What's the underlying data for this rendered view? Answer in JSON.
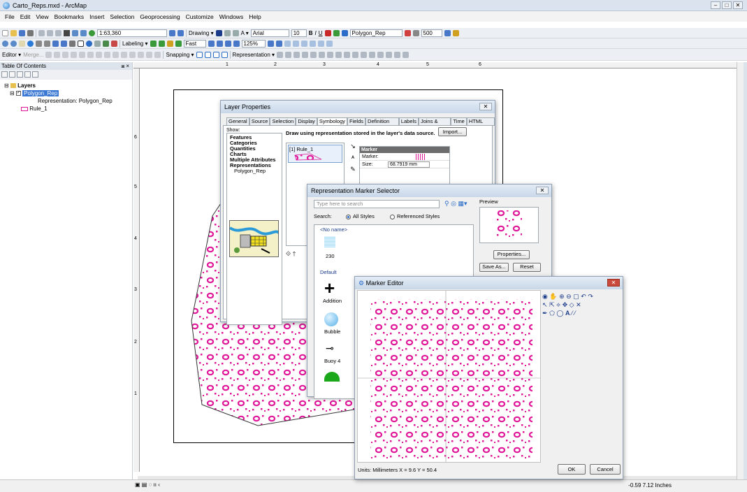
{
  "window": {
    "title": "Carto_Reps.mxd - ArcMap",
    "controls": [
      "–",
      "□",
      "✕"
    ]
  },
  "menu": [
    "File",
    "Edit",
    "View",
    "Bookmarks",
    "Insert",
    "Selection",
    "Geoprocessing",
    "Customize",
    "Windows",
    "Help"
  ],
  "toolbar1": {
    "scale": "1:63,360",
    "drawing_label": "Drawing ▾",
    "font": "Arial",
    "font_size": "10",
    "layer_combo": "Polygon_Rep",
    "value_500": "500"
  },
  "toolbar2": {
    "labeling_label": "Labeling ▾",
    "fast_combo": "Fast",
    "zoom_combo": "125%"
  },
  "toolbar3": {
    "editor_label": "Editor ▾",
    "merge_label": "Merge...",
    "snapping_label": "Snapping ▾",
    "representation_label": "Representation ▾"
  },
  "toc": {
    "title": "Table Of Contents",
    "pin": "⩏ ×",
    "layers_label": "Layers",
    "layer_name": "Polygon_Rep",
    "representation_text": "Representation: Polygon_Rep",
    "rule_label": "Rule_1"
  },
  "ruler": {
    "h_ticks": [
      "1",
      "2",
      "3",
      "4",
      "5",
      "6"
    ],
    "v_ticks": [
      "6",
      "5",
      "4",
      "3",
      "2",
      "1"
    ]
  },
  "status": {
    "coords": "-0.59  7.12 Inches"
  },
  "layer_properties": {
    "title": "Layer Properties",
    "close": "✕",
    "tabs": [
      "General",
      "Source",
      "Selection",
      "Display",
      "Symbology",
      "Fields",
      "Definition Query",
      "Labels",
      "Joins & Relates",
      "Time",
      "HTML Popup"
    ],
    "active_tab": "Symbology",
    "show_label": "Show:",
    "show_items": [
      "Features",
      "Categories",
      "Quantities",
      "Charts",
      "Multiple Attributes",
      "Representations"
    ],
    "show_sub": "Polygon_Rep",
    "draw_text": "Draw using representation stored in the layer's data source.",
    "import_button": "Import...",
    "rule_item": "[1] Rule_1",
    "marker_panel": {
      "header": "Marker",
      "marker_label": "Marker:",
      "size_label": "Size:",
      "size_value": "68.7919 mm"
    }
  },
  "marker_selector": {
    "title": "Representation Marker Selector",
    "close": "✕",
    "search_placeholder": "Type here to search",
    "search_label": "Search:",
    "all_styles": "All Styles",
    "referenced_styles": "Referenced Styles",
    "no_name": "<No name>",
    "item_230": "230",
    "default_label": "Default",
    "items": [
      "Addition",
      "Bubble",
      "Buoy 4"
    ],
    "preview_label": "Preview",
    "properties_button": "Properties...",
    "save_as_button": "Save As...",
    "reset_button": "Reset"
  },
  "marker_editor": {
    "title": "Marker Editor",
    "close": "✕",
    "units_text": "Units: Millimeters   X = 9.6   Y = 50.4",
    "ok_button": "OK",
    "cancel_button": "Cancel"
  },
  "colors": {
    "pattern": "#e0189a",
    "select_blue": "#3a78d4"
  }
}
